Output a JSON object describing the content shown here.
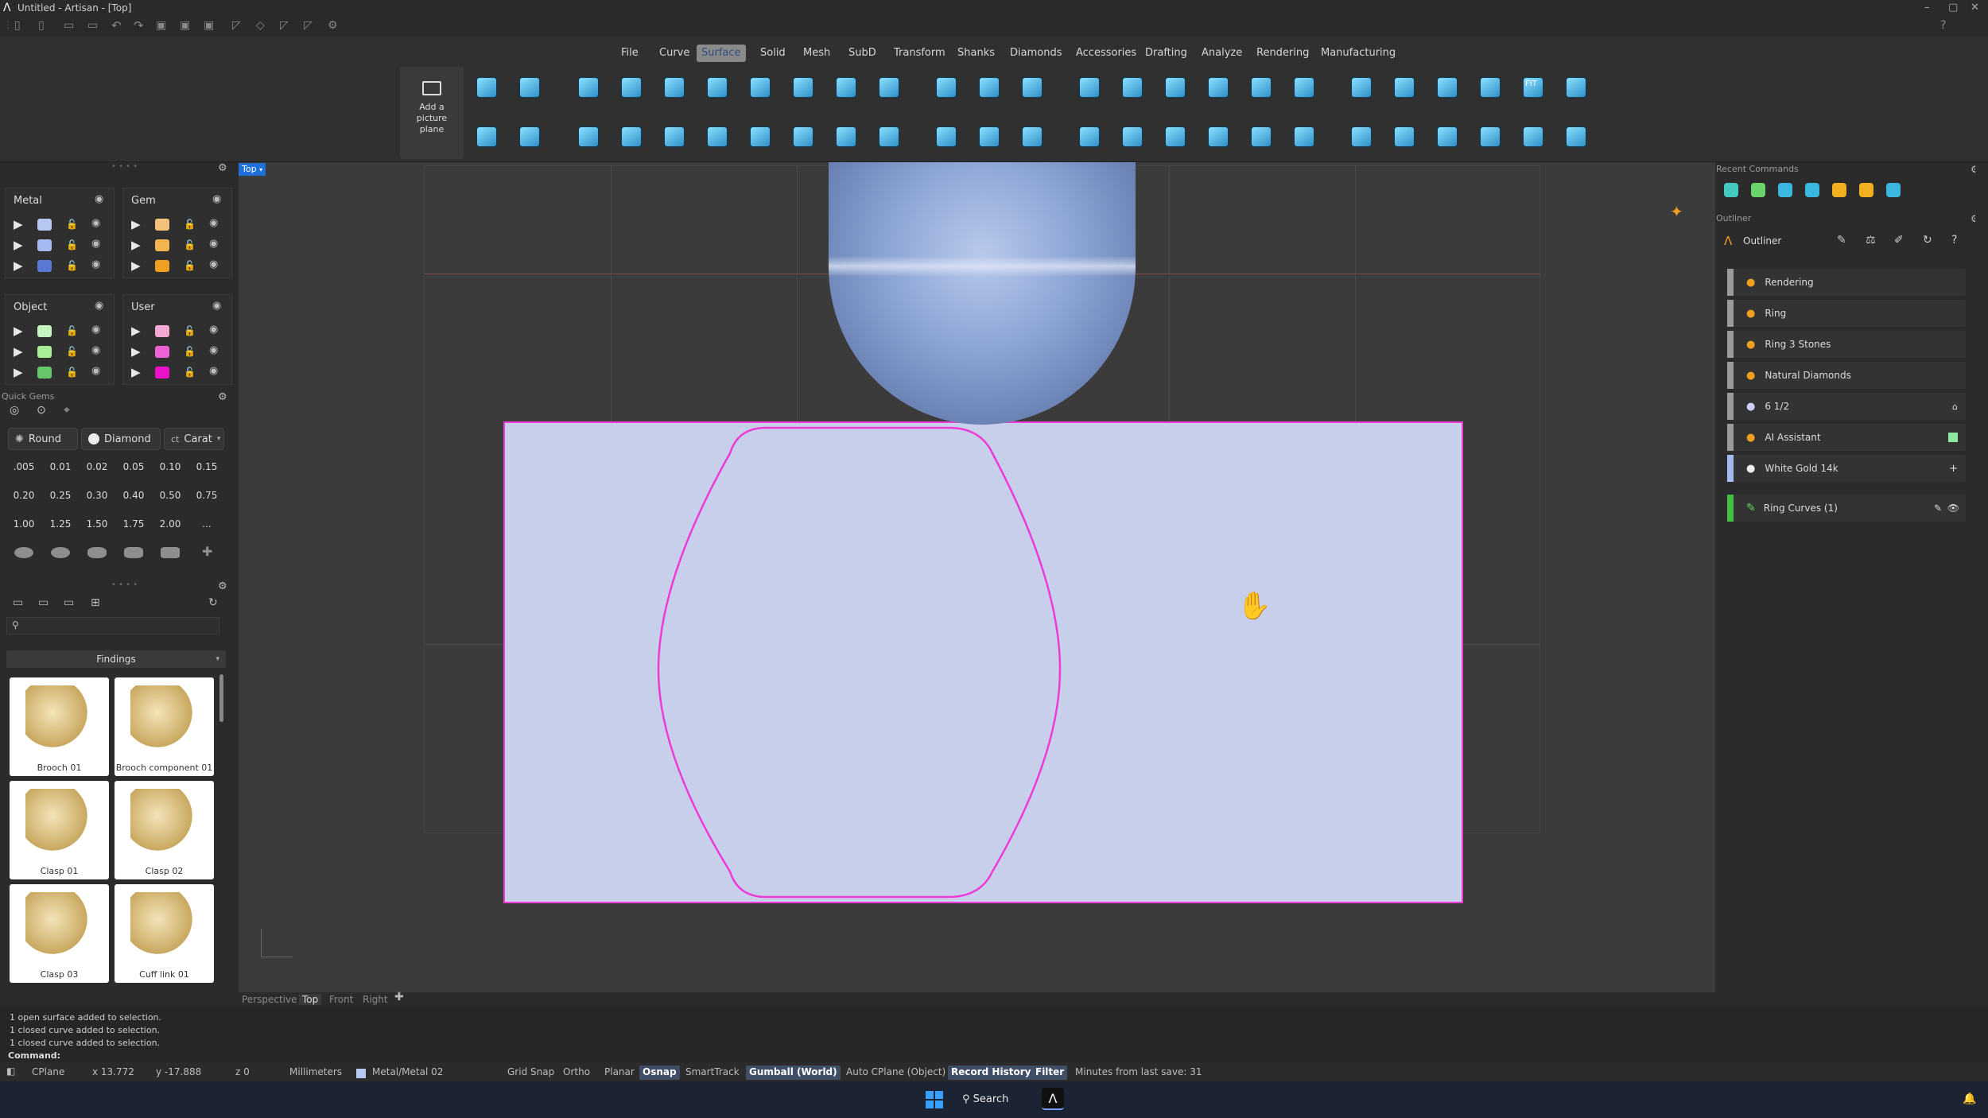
{
  "window": {
    "title": "Untitled - Artisan - [Top]"
  },
  "menu": {
    "tabs": [
      "File",
      "Curve",
      "Surface",
      "Solid",
      "Mesh",
      "SubD",
      "Transform",
      "Shanks",
      "Diamonds",
      "Accessories",
      "Drafting",
      "Analyze",
      "Rendering",
      "Manufacturing"
    ],
    "active": "Surface"
  },
  "ribbon": {
    "picture_plane_label": "Add a picture plane",
    "fit_label": "FIT"
  },
  "layers": {
    "metal": {
      "title": "Metal",
      "colors": [
        "#b7c8f3",
        "#a6baf2",
        "#5a79d6"
      ]
    },
    "gem": {
      "title": "Gem",
      "colors": [
        "#f3c27a",
        "#f1b44f",
        "#f0a020"
      ]
    },
    "object": {
      "title": "Object",
      "colors": [
        "#c6f5c2",
        "#a8ee97",
        "#66c86a"
      ]
    },
    "user": {
      "title": "User",
      "colors": [
        "#f3a9d4",
        "#ee62d7",
        "#ee11cc"
      ]
    }
  },
  "quick_gems": {
    "title": "Quick Gems",
    "shape": "Round",
    "cut": "Diamond",
    "unit": "Carat",
    "carats": [
      ".005",
      "0.01",
      "0.02",
      "0.05",
      "0.10",
      "0.15",
      "0.20",
      "0.25",
      "0.30",
      "0.40",
      "0.50",
      "0.75",
      "1.00",
      "1.25",
      "1.50",
      "1.75",
      "2.00",
      "..."
    ]
  },
  "library": {
    "category": "Findings",
    "items": [
      "Brooch 01",
      "Brooch component 01",
      "Clasp 01",
      "Clasp 02",
      "Clasp 03",
      "Cuff link 01"
    ]
  },
  "viewport": {
    "label": "Top",
    "tabs": [
      "Perspective",
      "Top",
      "Front",
      "Right"
    ],
    "active_tab": "Top"
  },
  "recent": {
    "title": "Recent Commands"
  },
  "outliner": {
    "section": "Outliner",
    "title": "Outliner",
    "items": [
      "Rendering",
      "Ring",
      "Ring 3 Stones",
      "Natural Diamonds",
      "6 1/2",
      "AI Assistant",
      "White Gold 14k"
    ],
    "curves": "Ring Curves (1)"
  },
  "command_history": [
    "1 open surface added to selection.",
    "1 closed curve added to selection.",
    "1 closed curve added to selection."
  ],
  "command_label": "Command:",
  "status": {
    "cplane": "CPlane",
    "x": "x 13.772",
    "y": "y -17.888",
    "z": "z 0",
    "units": "Millimeters",
    "layer": "Metal/Metal 02",
    "toggles": [
      "Grid Snap",
      "Ortho",
      "Planar",
      "Osnap",
      "SmartTrack",
      "Gumball (World)",
      "Auto CPlane (Object)",
      "Record History",
      "Filter"
    ],
    "on": [
      "Osnap",
      "Gumball (World)",
      "Record History",
      "Filter"
    ],
    "save": "Minutes from last save: 31"
  },
  "taskbar": {
    "search": "Search"
  }
}
